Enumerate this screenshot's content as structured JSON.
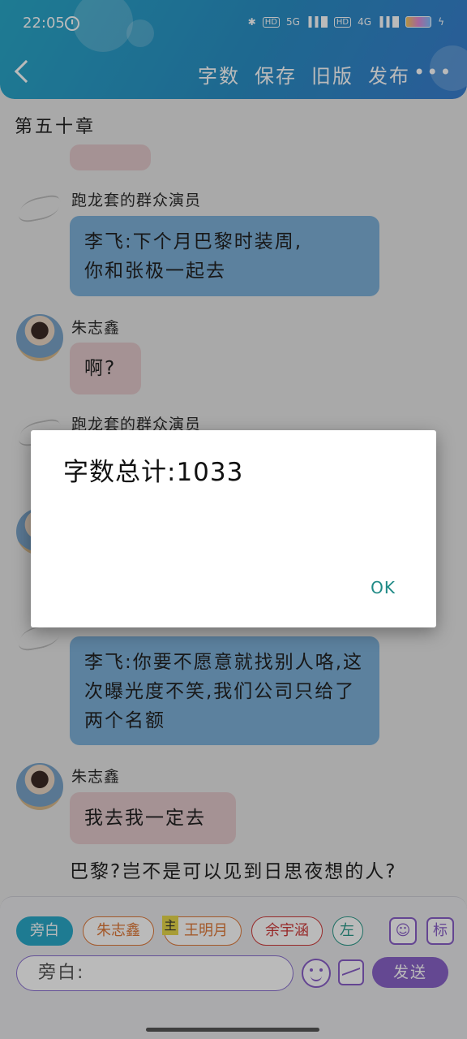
{
  "status_bar": {
    "time": "22:05",
    "network_5g": "5G",
    "hd_label": "HD",
    "network_4g": "4G"
  },
  "toolbar": {
    "actions": [
      "字数",
      "保存",
      "旧版",
      "发布"
    ],
    "more": "•••"
  },
  "chapter_title": "第五十章",
  "messages": [
    {
      "sender": "跑龙套的群众演员",
      "text": "李飞:下个月巴黎时装周,\n你和张极一起去",
      "style": "blue"
    },
    {
      "sender": "朱志鑫",
      "text": "啊?",
      "style": "pink"
    },
    {
      "sender": "跑龙套的群众演员",
      "text": "",
      "style": "blue"
    },
    {
      "sender": "",
      "text": "李飞:你要不愿意就找别人咯,这次曝光度不笑,我们公司只给了两个名额",
      "style": "blue"
    },
    {
      "sender": "朱志鑫",
      "text": "我去我一定去",
      "style": "pink"
    }
  ],
  "narration": "巴黎?岂不是可以见到日思夜想的人?",
  "role_chips": [
    "旁白",
    "朱志鑫",
    "王明月",
    "余宇涵",
    "左"
  ],
  "main_badge": "主",
  "tool_icon_label": "标",
  "input": {
    "value": "旁白:"
  },
  "send_label": "发送",
  "dialog": {
    "message": "字数总计:1033",
    "ok_label": "OK"
  },
  "colors": {
    "header": "#2a9ac9",
    "accent_purple": "#8a63c8",
    "bubble_blue": "#7fb1d9",
    "bubble_pink": "#e2c9cb",
    "ok_teal": "#1f8a86"
  }
}
